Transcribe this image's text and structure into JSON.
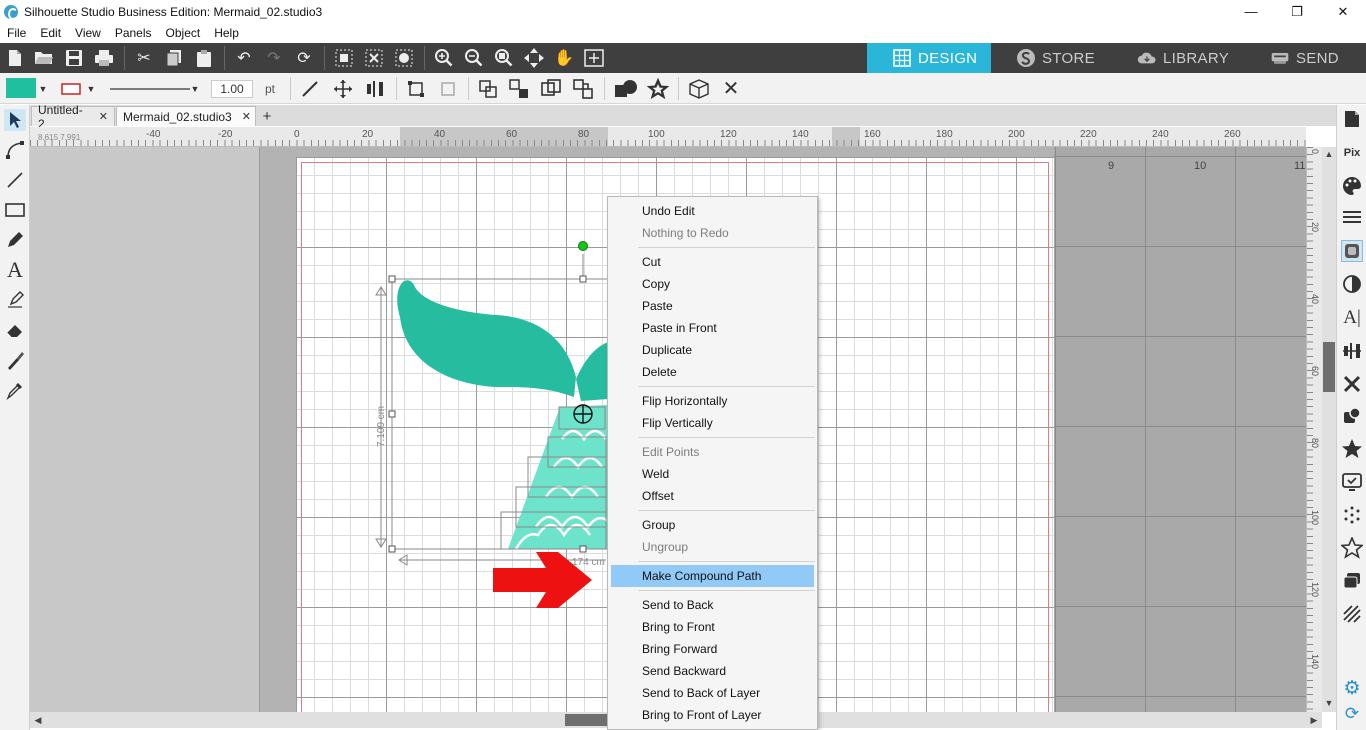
{
  "window": {
    "title": "Silhouette Studio Business Edition: Mermaid_02.studio3",
    "minimize": "—",
    "restore": "❐",
    "close": "✕"
  },
  "menubar": [
    "File",
    "Edit",
    "View",
    "Panels",
    "Object",
    "Help"
  ],
  "mode_tabs": {
    "design": "DESIGN",
    "store": "STORE",
    "library": "LIBRARY",
    "send": "SEND"
  },
  "toolbar2": {
    "fill_color": "#1fbf9f",
    "line_color": "#cc2222",
    "line_width": "1.00",
    "line_unit": "pt"
  },
  "doc_tabs": [
    {
      "label": "Untitled-2",
      "close": "✕"
    },
    {
      "label": "Mermaid_02.studio3",
      "close": "✕"
    }
  ],
  "add_tab": "+",
  "ruler": {
    "coords": "8.615 7.991",
    "h_labels": [
      "-40",
      "-20",
      "0",
      "20",
      "40",
      "60",
      "80",
      "100",
      "120",
      "140",
      "160",
      "180",
      "200",
      "220",
      "240",
      "260"
    ],
    "v_labels": [
      "0",
      "20",
      "40",
      "60",
      "80",
      "100",
      "120",
      "140"
    ]
  },
  "page_numbers": [
    "9",
    "10",
    "11"
  ],
  "dimensions": {
    "height_label": "7.109 cm",
    "width_label": "174 cm"
  },
  "shape_colors": {
    "tail": "#25bca0",
    "tail_light": "#6de3cb",
    "arrow": "#ee1111"
  },
  "context_menu": {
    "items": [
      {
        "label": "Undo Edit",
        "enabled": true
      },
      {
        "label": "Nothing to Redo",
        "enabled": false
      },
      {
        "sep": true
      },
      {
        "label": "Cut",
        "enabled": true
      },
      {
        "label": "Copy",
        "enabled": true
      },
      {
        "label": "Paste",
        "enabled": true
      },
      {
        "label": "Paste in Front",
        "enabled": true
      },
      {
        "label": "Duplicate",
        "enabled": true
      },
      {
        "label": "Delete",
        "enabled": true
      },
      {
        "sep": true
      },
      {
        "label": "Flip Horizontally",
        "enabled": true
      },
      {
        "label": "Flip Vertically",
        "enabled": true
      },
      {
        "sep": true
      },
      {
        "label": "Edit Points",
        "enabled": false
      },
      {
        "label": "Weld",
        "enabled": true
      },
      {
        "label": "Offset",
        "enabled": true
      },
      {
        "sep": true
      },
      {
        "label": "Group",
        "enabled": true
      },
      {
        "label": "Ungroup",
        "enabled": false
      },
      {
        "sep": true
      },
      {
        "label": "Make Compound Path",
        "enabled": true,
        "highlighted": true
      },
      {
        "sep": true
      },
      {
        "label": "Send to Back",
        "enabled": true
      },
      {
        "label": "Bring to Front",
        "enabled": true
      },
      {
        "label": "Bring Forward",
        "enabled": true
      },
      {
        "label": "Send Backward",
        "enabled": true
      },
      {
        "label": "Send to Back of Layer",
        "enabled": true
      },
      {
        "label": "Bring to Front of Layer",
        "enabled": true
      }
    ]
  }
}
